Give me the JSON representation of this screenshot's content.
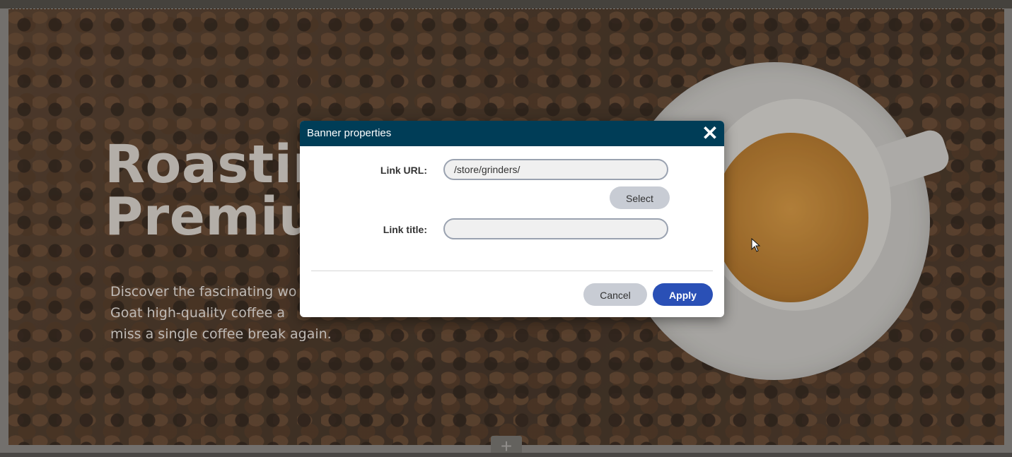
{
  "banner": {
    "title_line1": "Roastin",
    "title_line2": "Premiu",
    "subtitle_line1": "Discover the fascinating wo",
    "subtitle_line2": "Goat high-quality coffee a",
    "subtitle_line3": "miss a single coffee break again.",
    "add_icon": "plus-icon"
  },
  "dialog": {
    "title": "Banner properties",
    "close_icon": "close-icon",
    "link_url_label": "Link URL:",
    "link_url_value": "/store/grinders/",
    "select_label": "Select",
    "link_title_label": "Link title:",
    "link_title_value": "",
    "cancel_label": "Cancel",
    "apply_label": "Apply"
  },
  "colors": {
    "header_bg": "#003d57",
    "apply_bg": "#2a50b6",
    "secondary_btn_bg": "#c8ccd4"
  },
  "cursor": "arrow-cursor-icon"
}
